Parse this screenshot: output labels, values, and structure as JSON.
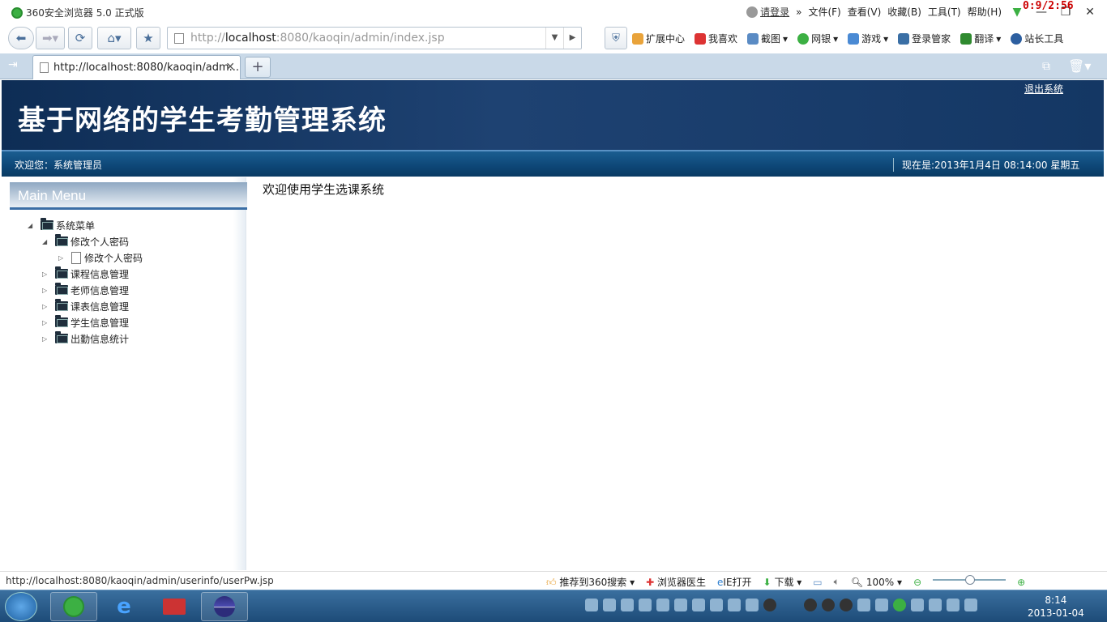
{
  "browser": {
    "title": "360安全浏览器 5.0 正式版",
    "timer": "0:9/2:56",
    "menu": {
      "login": "请登录",
      "file": "文件(F)",
      "view": "查看(V)",
      "favorites": "收藏(B)",
      "tools": "工具(T)",
      "help": "帮助(H)"
    },
    "address": {
      "prefix": "http://",
      "host": "localhost",
      "rest": ":8080/kaoqin/admin/index.jsp"
    },
    "toolbar": [
      "扩展中心",
      "我喜欢",
      "截图",
      "网银",
      "游戏",
      "登录管家",
      "翻译",
      "站长工具"
    ],
    "tab_title": "http://localhost:8080/kaoqin/adm...",
    "status_url": "http://localhost:8080/kaoqin/admin/userinfo/userPw.jsp",
    "status_tools": [
      "推荐到360搜索",
      "浏览器医生",
      "IE打开",
      "下载",
      "100%"
    ]
  },
  "app": {
    "system_name": "基于网络的学生考勤管理系统",
    "logout": "退出系统",
    "welcome": "欢迎您：系统管理员",
    "now": "现在是:2013年1月4日  08:14:00 星期五",
    "menu_title": "Main Menu",
    "tree": {
      "root": "系统菜单",
      "change_pwd_group": "修改个人密码",
      "change_pwd_item": "修改个人密码",
      "course": "课程信息管理",
      "teacher": "老师信息管理",
      "schedule": "课表信息管理",
      "student": "学生信息管理",
      "attendance": "出勤信息统计"
    },
    "main_text": "欢迎使用学生选课系统"
  },
  "taskbar": {
    "time": "8:14",
    "date": "2013-01-04"
  }
}
